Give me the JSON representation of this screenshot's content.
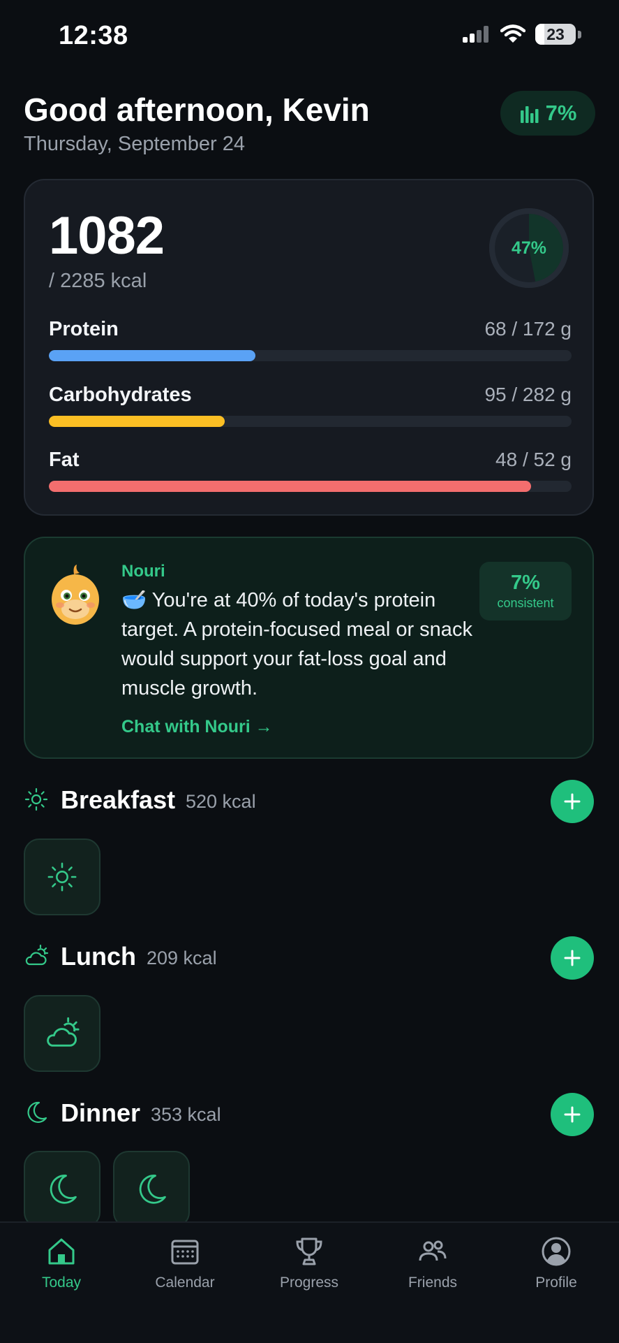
{
  "status_bar": {
    "time": "12:38",
    "battery": "23",
    "battery_level": 0.23
  },
  "header": {
    "greeting": "Good afternoon, Kevin",
    "date": "Thursday, September 24",
    "streak_badge": "7%"
  },
  "summary": {
    "calories_consumed": "1082",
    "calories_goal": "/ 2285 kcal",
    "ring_label": "47%",
    "ring_fraction": 0.47,
    "macros": [
      {
        "name": "Protein",
        "amount": "68 / 172 g",
        "fraction": 0.395,
        "color": "#5aa2f5"
      },
      {
        "name": "Carbohydrates",
        "amount": "95 / 282 g",
        "fraction": 0.337,
        "color": "#fbbf24"
      },
      {
        "name": "Fat",
        "amount": "48 / 52 g",
        "fraction": 0.923,
        "color": "#f36e6e"
      }
    ]
  },
  "coach": {
    "name": "Nouri",
    "message": "🥣 You're at 40% of today's protein target. A protein-focused meal or snack would support your fat-loss goal and muscle growth.",
    "link": "Chat with Nouri →",
    "consistency_value": "7%",
    "consistency_label": "consistent"
  },
  "meals": [
    {
      "name": "Breakfast",
      "kcal": "520 kcal",
      "icon": "sun-icon"
    },
    {
      "name": "Lunch",
      "kcal": "209 kcal",
      "icon": "cloud-sun-icon"
    },
    {
      "name": "Dinner",
      "kcal": "353 kcal",
      "icon": "moon-icon"
    }
  ],
  "tabs": [
    {
      "label": "Today",
      "icon": "home-icon",
      "active": true
    },
    {
      "label": "Calendar",
      "icon": "calendar-icon",
      "active": false
    },
    {
      "label": "Progress",
      "icon": "trophy-icon",
      "active": false
    },
    {
      "label": "Friends",
      "icon": "friends-icon",
      "active": false
    },
    {
      "label": "Profile",
      "icon": "profile-icon",
      "active": false
    }
  ],
  "colors": {
    "accent": "#34c98a",
    "add_button": "#1fbf7c",
    "background": "#0b0e12"
  }
}
